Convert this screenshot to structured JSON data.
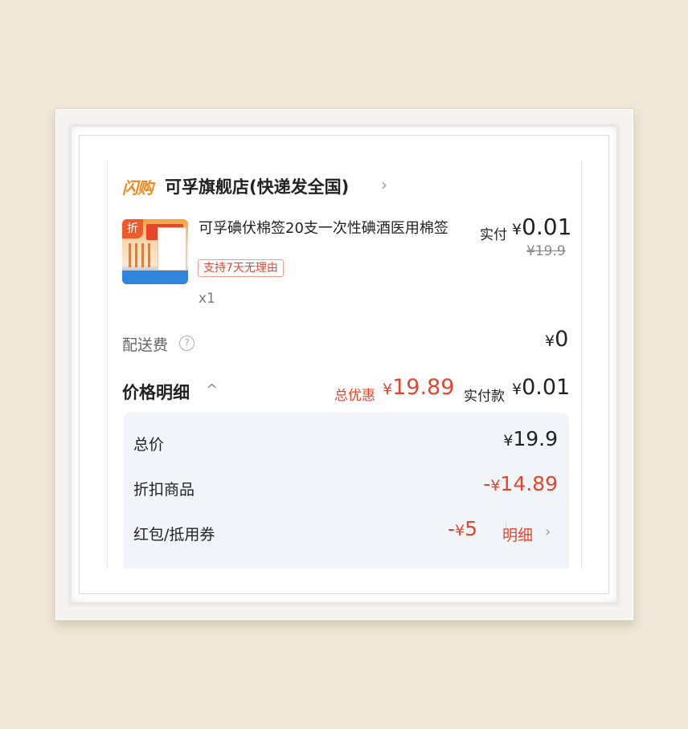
{
  "shop": {
    "badge": "闪购",
    "name": "可孚旗舰店(快递发全国)",
    "chevron": "›"
  },
  "product": {
    "thumb_tag": "折",
    "name": "可孚碘伏棉签20支一次性碘酒医用棉签",
    "return_policy": "支持7天无理由",
    "quantity": "x1",
    "paid_label": "实付",
    "paid_value": "0.01",
    "original_price": "¥19.9"
  },
  "shipping": {
    "label": "配送费",
    "help_icon": "?",
    "value": "0"
  },
  "price_details": {
    "title": "价格明细",
    "chevron": "^",
    "discount_label": "总优惠",
    "discount_value": "19.89",
    "pay_label": "实付款",
    "pay_value": "0.01",
    "rows": [
      {
        "label": "总价",
        "value": "19.9",
        "sign": ""
      },
      {
        "label": "折扣商品",
        "value": "14.89",
        "sign": "-"
      },
      {
        "label": "红包/抵用券",
        "value": "5",
        "sign": "-"
      }
    ],
    "detail_link": "明细",
    "detail_chevron": "›"
  },
  "currency": "¥",
  "colors": {
    "accent_orange": "#f08a1c",
    "discount_red": "#e8452f",
    "detail_bg": "#f1f4f9"
  }
}
